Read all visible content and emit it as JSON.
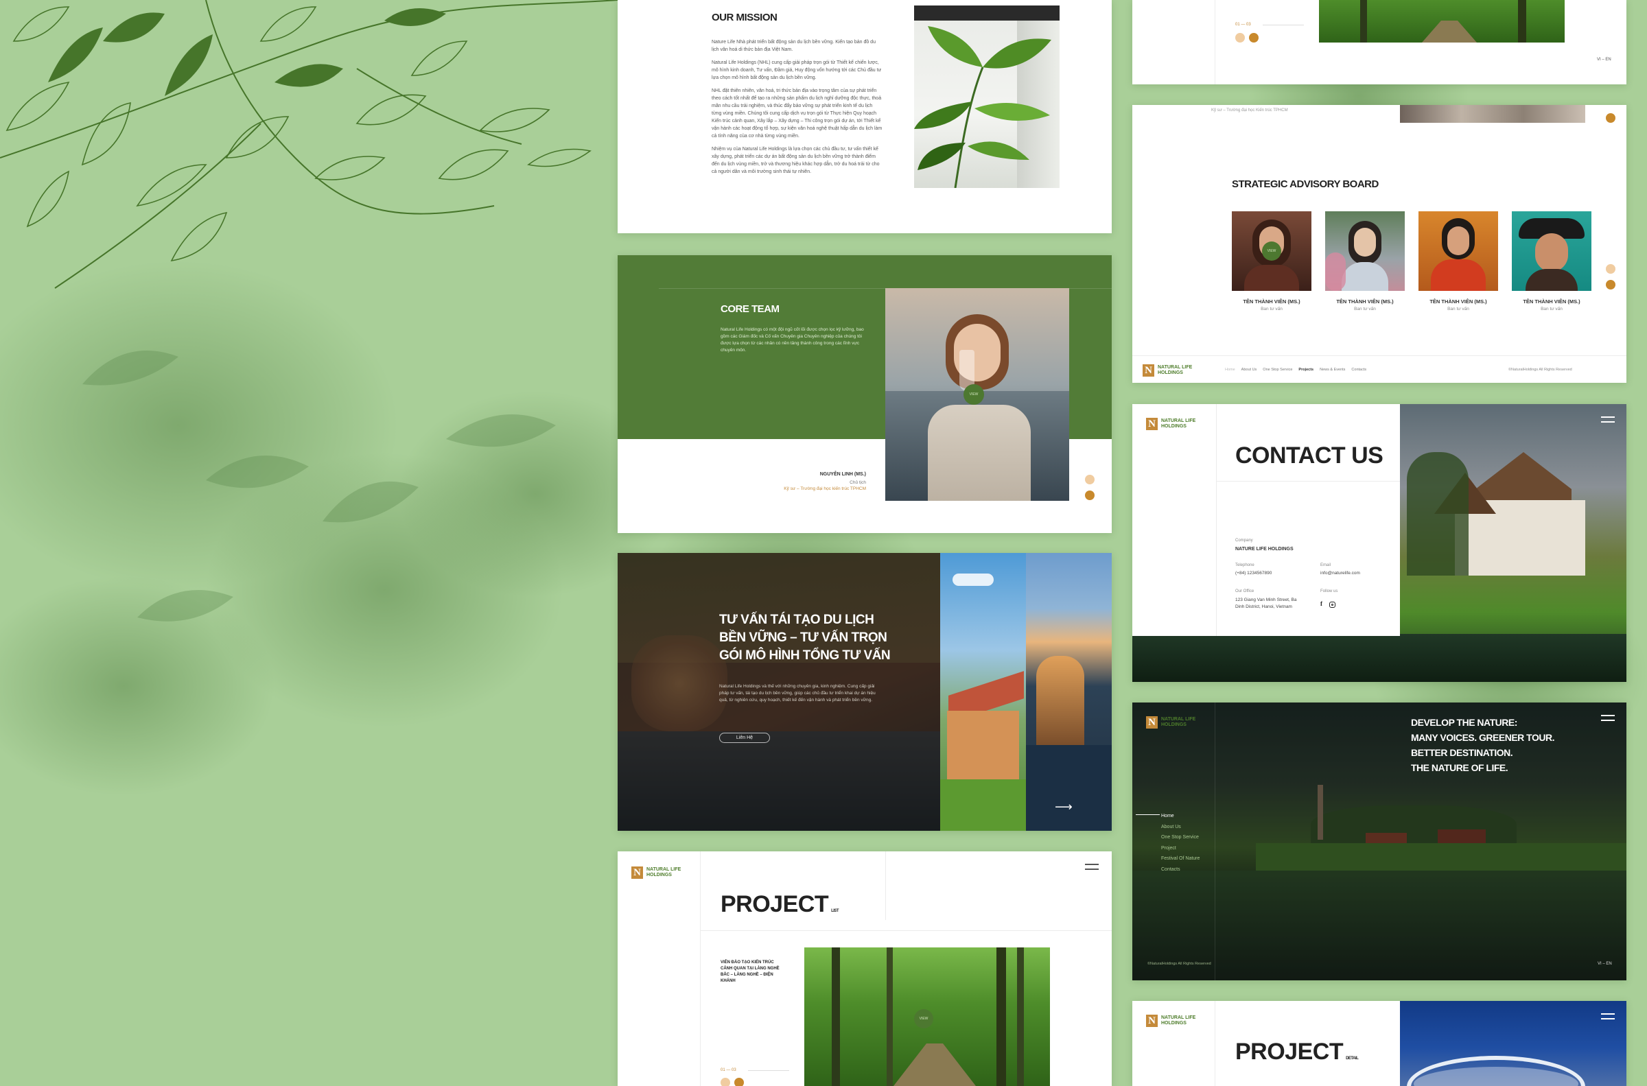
{
  "colors": {
    "background": "#a9cf98",
    "brand_green": "#527c37",
    "accent_gold": "#c8892c",
    "accent_peach": "#f0cca0",
    "text_dark": "#333333"
  },
  "mission": {
    "title": "OUR MISSION",
    "p1": "Nature Life Nhà phát triển bất động sản du lịch bền vững. Kiến tạo bản đồ du lịch văn hoá di thức bản địa Việt Nam.",
    "p2": "Natural Life Holdings (NHL) cung cấp giải pháp trọn gói từ Thiết kế chiến lược, mô hình kinh doanh, Tư vấn, Đầm giá, Huy động vốn hướng tới các Chủ đầu tư lựa chọn mô hình bất động sản du lịch bền vững.",
    "p3": "NHL đặt thiên nhiên, văn hoá, tri thức bản địa vào trọng tâm của sự phát triển theo cách tốt nhất để tạo ra những sản phẩm du lịch nghỉ dưỡng độc thực, thoả mãn nhu cầu trải nghiệm, và thúc đẩy bảo vững sự phát triển kinh tế du lịch từng vùng miền. Chúng tôi cung cấp dịch vụ trọn gói từ Thực hiện Quy hoạch Kiến trúc cảnh quan, Xây lắp – Xây dựng – Thi công trọn gói dự án, tới Thiết kế vận hành các hoạt động tổ hợp, sự kiện văn hoá nghệ thuật hấp dẫn du lịch làm cả tính năng của cơ nhà từng vùng miền.",
    "p4": "Nhiệm vụ của Natural Life Holdings là lựa chọn các chủ đầu tư, tư vấn thiết kế xây dựng, phát triển các dự án bất động sản du lịch bền vững trở thành điểm đến du lịch vùng miền, trở và thương hiệu khác hợp dẫn, trở du hoá trải từ cho cả người dân và môi trường sinh thái tự nhiên."
  },
  "core_team": {
    "title": "CORE TEAM",
    "text": "Natural Life Holdings có một đội ngũ cốt lõi được chọn lọc kỹ lưỡng, bao gồm các Giám đốc và Cố vấn Chuyên gia Chuyên nghiệp của chúng tôi được lựa chọn từ các nhân có nền tảng thành công trong các lĩnh vực chuyên môn.",
    "badge": "VIEW",
    "name": "NGUYỄN LINH (MS.)",
    "role": "Chủ tịch",
    "desc": "Kỹ sư – Trường đại học kiến trúc TPHCM"
  },
  "consulting": {
    "title": "TƯ VẤN TÁI TẠO DU LỊCH BỀN VỮNG – TƯ VẤN TRỌN GÓI MÔ HÌNH TỔNG TƯ VẤN",
    "text": "Natural Life Holdings và thế với những chuyên gia, kinh nghiệm. Cung cấp giải pháp tư vấn, tái tạo du lịch bền vững, giúp các chủ đầu tư triển khai dự án hiệu quả, từ nghiên cứu, quy hoạch, thiết kế đến vận hành và phát triển bền vững.",
    "button": "Liên Hệ",
    "arrow": "⟶"
  },
  "project_list": {
    "brand": [
      "NATURAL LIFE",
      "HOLDINGS"
    ],
    "title": "PROJECT",
    "suffix": "LIST",
    "item": "VIÊN ĐÀO TẠO KIẾN TRÚC CẢNH QUAN TẠI LÀNG NGHỀ BẮC – LÀNG NGHỀ – ĐIỆN KHÁNH",
    "badge": "VIEW",
    "counter": "01 — 03"
  },
  "top_project": {
    "counter": "01 — 03",
    "lang": "VI – EN"
  },
  "advisory": {
    "caption": "Kỹ sư – Trường đại học Kiến trúc TPHCM",
    "title": "STRATEGIC ADVISORY BOARD",
    "badge": "VIEW",
    "members": [
      {
        "name": "TÊN THÀNH VIÊN (MS.)",
        "role": "Ban tư vấn"
      },
      {
        "name": "TÊN THÀNH VIÊN (MS.)",
        "role": "Ban tư vấn"
      },
      {
        "name": "TÊN THÀNH VIÊN (MS.)",
        "role": "Ban tư vấn"
      },
      {
        "name": "TÊN THÀNH VIÊN (MS.)",
        "role": "Ban tư vấn"
      }
    ],
    "brand": [
      "NATURAL LIFE",
      "HOLDINGS"
    ],
    "nav": [
      "Home",
      "About Us",
      "One Stop Service",
      "Projects",
      "News & Events",
      "Contacts"
    ],
    "copyright": "©NaturalHoldings All Rights Reserved"
  },
  "contact": {
    "brand": [
      "NATURAL LIFE",
      "HOLDINGS"
    ],
    "title": "CONTACT US",
    "company_label": "Company",
    "company": "NATURE LIFE HOLDINGS",
    "tel_label": "Telephone",
    "tel": "(+84) 1234567890",
    "email_label": "Email",
    "email": "info@naturelife.com",
    "office_label": "Our Office",
    "office": "123 Giang Van Minh Street, Ba Dinh District, Hanoi, Vietnam",
    "follow_label": "Follow us"
  },
  "hero": {
    "brand": [
      "NATURAL LIFE",
      "HOLDINGS"
    ],
    "headline": [
      "DEVELOP THE NATURE:",
      "MANY VOICES. GREENER TOUR.",
      "BETTER DESTINATION.",
      "THE NATURE OF LIFE."
    ],
    "menu": [
      "Home",
      "About Us",
      "One Stop Service",
      "Project",
      "Festival Of Nature",
      "Contacts"
    ],
    "copyright": "©NaturalHoldings All Rights Reserved",
    "lang": "VI – EN"
  },
  "project_detail": {
    "brand": [
      "NATURAL LIFE",
      "HOLDINGS"
    ],
    "title": "PROJECT",
    "suffix": "DETAIL"
  }
}
